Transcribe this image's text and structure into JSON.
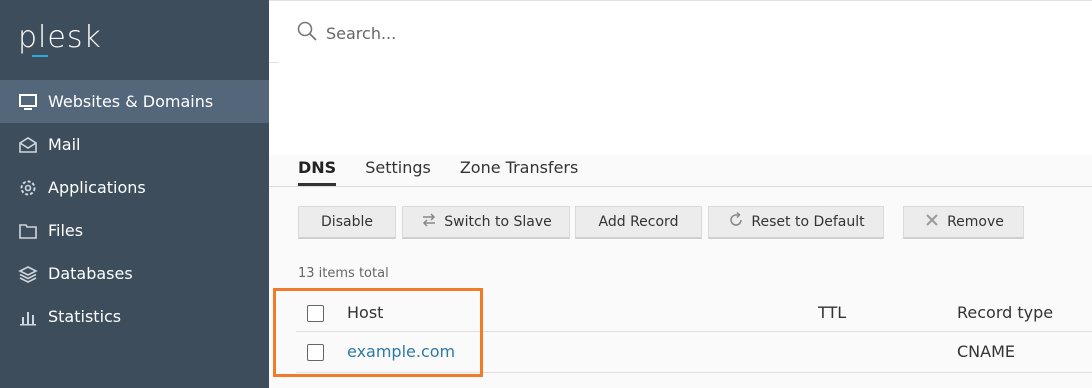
{
  "app": {
    "logo": "plesk"
  },
  "sidebar": {
    "items": [
      {
        "label": "Websites & Domains",
        "icon": "monitor-icon",
        "active": true
      },
      {
        "label": "Mail",
        "icon": "envelope-icon"
      },
      {
        "label": "Applications",
        "icon": "gear-icon"
      },
      {
        "label": "Files",
        "icon": "folder-icon"
      },
      {
        "label": "Databases",
        "icon": "layers-icon"
      },
      {
        "label": "Statistics",
        "icon": "bar-chart-icon"
      }
    ]
  },
  "search": {
    "placeholder": "Search..."
  },
  "tabs": [
    {
      "label": "DNS",
      "active": true
    },
    {
      "label": "Settings"
    },
    {
      "label": "Zone Transfers"
    }
  ],
  "toolbar": {
    "disable": "Disable",
    "switch_to_slave": "Switch to Slave",
    "add_record": "Add Record",
    "reset_to_default": "Reset to Default",
    "remove": "Remove"
  },
  "list": {
    "total": "13 items total",
    "columns": {
      "host": "Host",
      "ttl": "TTL",
      "record_type": "Record type"
    },
    "rows": [
      {
        "host": "example.com",
        "ttl": "",
        "record_type": "CNAME"
      }
    ]
  },
  "colors": {
    "sidebar_bg": "#3e4d5c",
    "sidebar_active": "#53667a",
    "link": "#2b7aa7",
    "highlight": "#f07c2a"
  }
}
